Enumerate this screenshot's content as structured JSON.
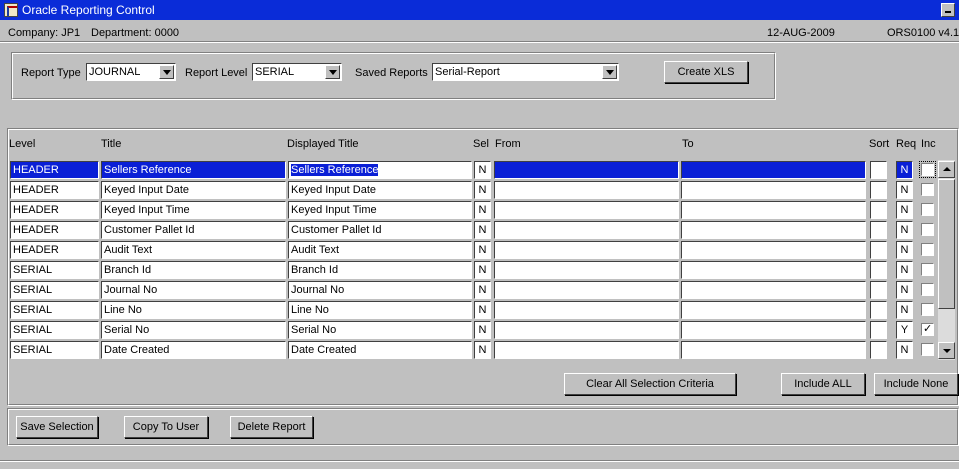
{
  "window": {
    "title": "Oracle Reporting Control"
  },
  "info": {
    "company": "Company:  JP1",
    "department": "Department:  0000",
    "date": "12-AUG-2009",
    "version": "ORS0100  v4.1"
  },
  "filters": {
    "report_type_label": "Report Type",
    "report_type_value": "JOURNAL",
    "report_level_label": "Report Level",
    "report_level_value": "SERIAL",
    "saved_reports_label": "Saved Reports",
    "saved_reports_value": "Serial-Report",
    "create_xls_label": "Create XLS"
  },
  "columns": {
    "level": "Level",
    "title": "Title",
    "displayed_title": "Displayed Title",
    "sel": "Sel",
    "from": "From",
    "to": "To",
    "sort": "Sort",
    "req": "Req",
    "inc": "Inc"
  },
  "rows": [
    {
      "level": "HEADER",
      "title": "Sellers Reference",
      "displayed": "Sellers Reference",
      "sel": "N",
      "from": "",
      "to": "",
      "sort": "",
      "req": "N",
      "inc": false
    },
    {
      "level": "HEADER",
      "title": "Keyed Input Date",
      "displayed": "Keyed Input Date",
      "sel": "N",
      "from": "",
      "to": "",
      "sort": "",
      "req": "N",
      "inc": false
    },
    {
      "level": "HEADER",
      "title": "Keyed Input Time",
      "displayed": "Keyed Input Time",
      "sel": "N",
      "from": "",
      "to": "",
      "sort": "",
      "req": "N",
      "inc": false
    },
    {
      "level": "HEADER",
      "title": "Customer Pallet Id",
      "displayed": "Customer Pallet Id",
      "sel": "N",
      "from": "",
      "to": "",
      "sort": "",
      "req": "N",
      "inc": false
    },
    {
      "level": "HEADER",
      "title": "Audit Text",
      "displayed": "Audit Text",
      "sel": "N",
      "from": "",
      "to": "",
      "sort": "",
      "req": "N",
      "inc": false
    },
    {
      "level": "SERIAL",
      "title": "Branch Id",
      "displayed": "Branch Id",
      "sel": "N",
      "from": "",
      "to": "",
      "sort": "",
      "req": "N",
      "inc": false
    },
    {
      "level": "SERIAL",
      "title": "Journal No",
      "displayed": "Journal No",
      "sel": "N",
      "from": "",
      "to": "",
      "sort": "",
      "req": "N",
      "inc": false
    },
    {
      "level": "SERIAL",
      "title": "Line No",
      "displayed": "Line No",
      "sel": "N",
      "from": "",
      "to": "",
      "sort": "",
      "req": "N",
      "inc": false
    },
    {
      "level": "SERIAL",
      "title": "Serial No",
      "displayed": "Serial No",
      "sel": "N",
      "from": "",
      "to": "",
      "sort": "",
      "req": "Y",
      "inc": true
    },
    {
      "level": "SERIAL",
      "title": "Date Created",
      "displayed": "Date Created",
      "sel": "N",
      "from": "",
      "to": "",
      "sort": "",
      "req": "N",
      "inc": false
    }
  ],
  "table_actions": {
    "clear_all": "Clear All Selection Criteria",
    "include_all": "Include ALL",
    "include_none": "Include None"
  },
  "footer": {
    "save_selection": "Save Selection",
    "copy_to_user": "Copy To User",
    "delete_report": "Delete Report"
  },
  "colors": {
    "titlebar": "#0a2cd8",
    "selection": "#0a1fd6",
    "face": "#c0c0c0"
  }
}
